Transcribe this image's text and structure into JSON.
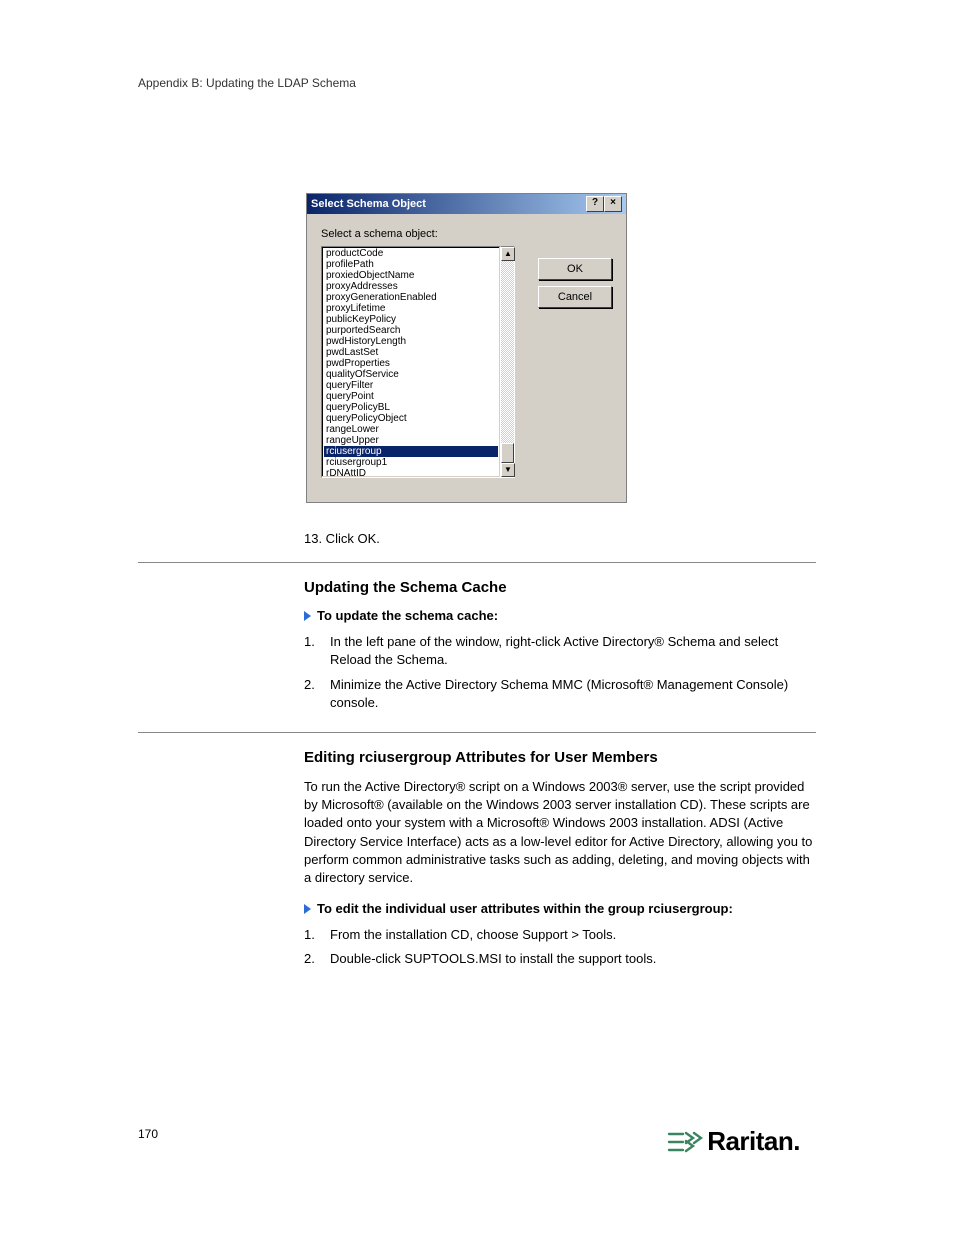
{
  "page": {
    "header": "Appendix B: Updating the LDAP Schema",
    "number": "170"
  },
  "dialog": {
    "title": "Select Schema Object",
    "label": "Select a schema object:",
    "help_btn": "?",
    "close_btn": "×",
    "scroll_up": "▲",
    "scroll_down": "▼",
    "ok": "OK",
    "cancel": "Cancel",
    "items": [
      "productCode",
      "profilePath",
      "proxiedObjectName",
      "proxyAddresses",
      "proxyGenerationEnabled",
      "proxyLifetime",
      "publicKeyPolicy",
      "purportedSearch",
      "pwdHistoryLength",
      "pwdLastSet",
      "pwdProperties",
      "qualityOfService",
      "queryFilter",
      "queryPoint",
      "queryPolicyBL",
      "queryPolicyObject",
      "rangeLower",
      "rangeUpper",
      "rciusergroup",
      "rciusergroup1",
      "rDNAttID"
    ],
    "selected_index": 18
  },
  "body": {
    "p1": "13. Click OK.",
    "sec1_title": "Updating the Schema Cache",
    "proc1_head": "To update the schema cache:",
    "proc1_items": [
      "In the left pane of the window, right-click Active Directory® Schema and select Reload the Schema.",
      "Minimize the Active Directory Schema MMC (Microsoft® Management Console) console."
    ],
    "sec2_title": "Editing rciusergroup Attributes for User Members",
    "p2": "To run the Active Directory® script on a Windows 2003® server, use the script provided by Microsoft® (available on the Windows 2003 server installation CD). These scripts are loaded onto your system with a Microsoft® Windows 2003 installation. ADSI (Active Directory Service Interface) acts as a low-level editor for Active Directory, allowing you to perform common administrative tasks such as adding, deleting, and moving objects with a directory service.",
    "proc2_head": "To edit the individual user attributes within the group rciusergroup:",
    "proc2_items": [
      "From the installation CD, choose Support > Tools.",
      "Double-click SUPTOOLS.MSI to install the support tools."
    ]
  },
  "logo": {
    "text": "Raritan."
  }
}
